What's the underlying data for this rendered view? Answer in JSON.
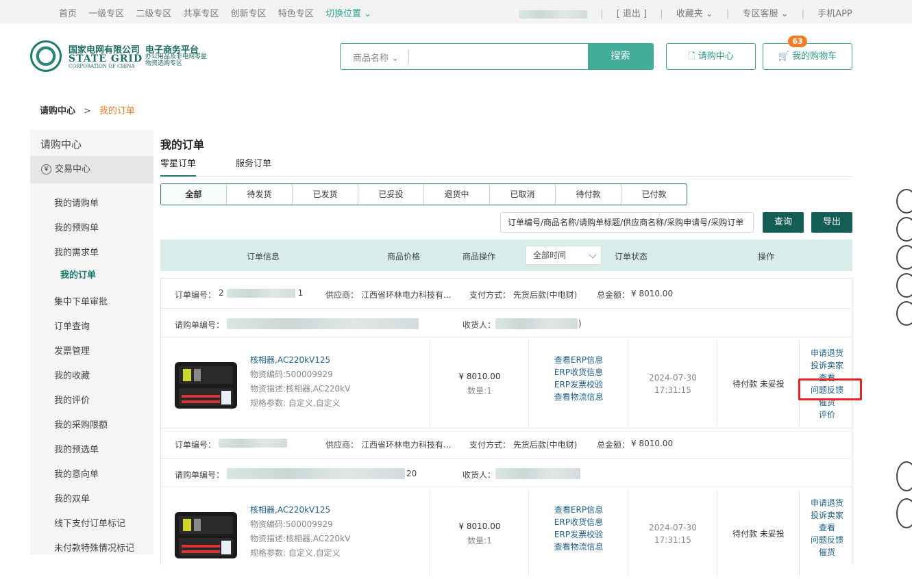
{
  "topbar": {
    "nav": [
      "首页",
      "一级专区",
      "二级专区",
      "共享专区",
      "创新专区",
      "特色专区"
    ],
    "switch": "切换位置",
    "logout": "[ 退出 ]",
    "favorites": "收藏夹",
    "service": "专区客服",
    "app": "手机APP"
  },
  "logo": {
    "cn": "国家电网有限公司",
    "en": "STATE GRID",
    "en2": "CORPORATION OF CHINA",
    "platform": "电子商务平台",
    "platform_sub": "办公用品及非电网零星物资选购专区"
  },
  "search": {
    "category": "商品名称",
    "button": "搜索",
    "value": ""
  },
  "header": {
    "request_center": "请购中心",
    "cart": "我的购物车",
    "cart_count": "63"
  },
  "breadcrumb": {
    "root": "请购中心",
    "sep": ">",
    "current": "我的订单"
  },
  "sidebar": {
    "heading": "请购中心",
    "trade": "交易中心",
    "items": [
      "我的请购单",
      "我的预购单",
      "我的需求单",
      "我的订单",
      "集中下单审批",
      "订单查询",
      "发票管理",
      "我的收藏",
      "我的评价",
      "我的采购限额",
      "我的预选单",
      "我的意向单",
      "我的双单",
      "线下支付订单标记",
      "未付款特殊情况标记"
    ]
  },
  "main": {
    "title": "我的订单",
    "tabs": [
      "零星订单",
      "服务订单"
    ],
    "filters": [
      "全部",
      "待发货",
      "已发货",
      "已妥投",
      "退货中",
      "已取消",
      "待付款",
      "已付款"
    ],
    "query_placeholder": "订单编号/商品名称/请购单标题/供应商名称/采购申请号/采购订单",
    "query": "查询",
    "export": "导出"
  },
  "table_header": {
    "info": "订单信息",
    "price": "商品价格",
    "ops": "商品操作",
    "time_select": "全部时间",
    "status": "订单状态",
    "actions": "操作"
  },
  "orders": [
    {
      "order_no_label": "订单编号：",
      "order_no_tail": "1",
      "supplier_label": "供应商：",
      "supplier": "江西省环林电力科技有...",
      "pay_label": "支付方式：",
      "pay": "先货后款(中电财)",
      "total_label": "总金额：",
      "total": "¥ 8010.00",
      "req_label": "请购单编号：",
      "receiver_label": "收货人：",
      "receiver_tail": ")",
      "product": "核相器,AC220kV125",
      "code": "物资编码:500009929",
      "desc": "物资描述:核相器,AC220kV",
      "spec": "规格参数: 自定义,自定义",
      "price": "¥ 8010.00",
      "qty": "数量:1",
      "ops": [
        "查看ERP信息",
        "ERP收货信息",
        "ERP发票校验",
        "查看物流信息"
      ],
      "date": "2024-07-30",
      "time": "17:31:15",
      "status": "待付款 未妥投",
      "actions": [
        "申请退货",
        "投诉卖家",
        "查看",
        "问题反馈",
        "催货",
        "评价"
      ]
    },
    {
      "order_no_label": "订单编号：",
      "order_no_tail": "",
      "supplier_label": "供应商：",
      "supplier": "江西省环林电力科技有...",
      "pay_label": "支付方式：",
      "pay": "先货后款(中电财)",
      "total_label": "总金额：",
      "total": "¥ 8010.00",
      "req_label": "请购单编号：",
      "req_tail": "20",
      "receiver_label": "收货人：",
      "receiver_tail": "",
      "product": "核相器,AC220kV125",
      "code": "物资编码:500009929",
      "desc": "物资描述:核相器,AC220kV",
      "spec": "规格参数: 自定义,自定义",
      "price": "¥ 8010.00",
      "qty": "数量:1",
      "ops": [
        "查看ERP信息",
        "ERP收货信息",
        "ERP发票校验",
        "查看物流信息"
      ],
      "date": "2024-07-30",
      "time": "17:31:15",
      "status": "待付款 未妥投",
      "actions": [
        "申请退货",
        "投诉卖家",
        "查看",
        "问题反馈",
        "催货"
      ]
    }
  ],
  "colors": {
    "accent": "#42ae99",
    "dark": "#155e55",
    "orange": "#f07c2a",
    "highlight": "#ee2222"
  },
  "float_icons": [
    "cart-icon",
    "bag-icon",
    "edit-icon",
    "help-icon",
    "qrcode-icon",
    "top-icon",
    "down-icon"
  ]
}
